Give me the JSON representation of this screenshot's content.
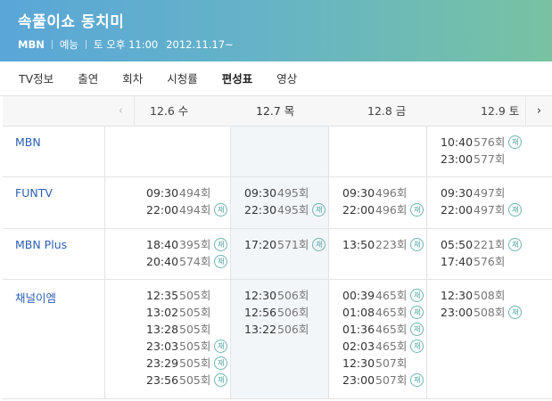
{
  "program": {
    "title": "속풀이쇼 동치미",
    "channel": "MBN",
    "genre": "예능",
    "airtime": "토 오후 11:00",
    "start_date": "2012.11.17~"
  },
  "tabs": [
    "TV정보",
    "출연",
    "회차",
    "시청률",
    "편성표",
    "영상"
  ],
  "active_tab": "편성표",
  "dates": [
    "12.6 수",
    "12.7 목",
    "12.8 금",
    "12.9 토"
  ],
  "rerun_label": "재",
  "rows": [
    {
      "channel": "MBN",
      "cells": [
        [],
        [],
        [],
        [
          {
            "time": "10:40",
            "ep": "576회",
            "re": true
          },
          {
            "time": "23:00",
            "ep": "577회",
            "re": false
          }
        ]
      ]
    },
    {
      "channel": "FUNTV",
      "cells": [
        [
          {
            "time": "09:30",
            "ep": "494회",
            "re": false
          },
          {
            "time": "22:00",
            "ep": "494회",
            "re": true
          }
        ],
        [
          {
            "time": "09:30",
            "ep": "495회",
            "re": false
          },
          {
            "time": "22:30",
            "ep": "495회",
            "re": true
          }
        ],
        [
          {
            "time": "09:30",
            "ep": "496회",
            "re": false
          },
          {
            "time": "22:00",
            "ep": "496회",
            "re": true
          }
        ],
        [
          {
            "time": "09:30",
            "ep": "497회",
            "re": false
          },
          {
            "time": "22:00",
            "ep": "497회",
            "re": true
          }
        ]
      ]
    },
    {
      "channel": "MBN Plus",
      "cells": [
        [
          {
            "time": "18:40",
            "ep": "395회",
            "re": true
          },
          {
            "time": "20:40",
            "ep": "574회",
            "re": true
          }
        ],
        [
          {
            "time": "17:20",
            "ep": "571회",
            "re": true
          }
        ],
        [
          {
            "time": "13:50",
            "ep": "223회",
            "re": true
          }
        ],
        [
          {
            "time": "05:50",
            "ep": "221회",
            "re": true
          },
          {
            "time": "17:40",
            "ep": "576회",
            "re": false
          }
        ]
      ]
    },
    {
      "channel": "채널이엠",
      "cells": [
        [
          {
            "time": "12:35",
            "ep": "505회",
            "re": false
          },
          {
            "time": "13:02",
            "ep": "505회",
            "re": false
          },
          {
            "time": "13:28",
            "ep": "505회",
            "re": false
          },
          {
            "time": "23:03",
            "ep": "505회",
            "re": true
          },
          {
            "time": "23:29",
            "ep": "505회",
            "re": true
          },
          {
            "time": "23:56",
            "ep": "505회",
            "re": true
          }
        ],
        [
          {
            "time": "12:30",
            "ep": "506회",
            "re": false
          },
          {
            "time": "12:56",
            "ep": "506회",
            "re": false
          },
          {
            "time": "13:22",
            "ep": "506회",
            "re": false
          }
        ],
        [
          {
            "time": "00:39",
            "ep": "465회",
            "re": true
          },
          {
            "time": "01:08",
            "ep": "465회",
            "re": true
          },
          {
            "time": "01:36",
            "ep": "465회",
            "re": true
          },
          {
            "time": "02:03",
            "ep": "465회",
            "re": true
          },
          {
            "time": "12:30",
            "ep": "507회",
            "re": false
          },
          {
            "time": "23:00",
            "ep": "507회",
            "re": true
          }
        ],
        [
          {
            "time": "12:30",
            "ep": "508회",
            "re": false
          },
          {
            "time": "23:00",
            "ep": "508회",
            "re": true
          }
        ]
      ]
    }
  ]
}
